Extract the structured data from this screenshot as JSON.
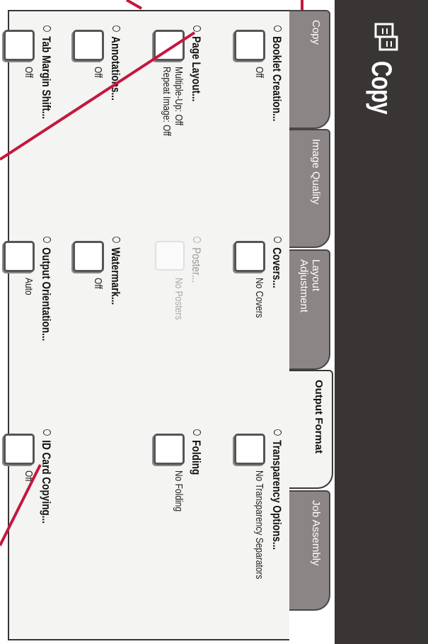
{
  "header": {
    "title": "Copy",
    "icon": "copier-icon"
  },
  "tabs": [
    {
      "label": "Copy",
      "active": false
    },
    {
      "label": "Image Quality",
      "active": false
    },
    {
      "label": "Layout\nAdjustment",
      "active": false
    },
    {
      "label": "Output Format",
      "active": true
    },
    {
      "label": "Job Assembly",
      "active": false
    }
  ],
  "features": {
    "booklet_creation": {
      "label": "Booklet Creation...",
      "value": "Off"
    },
    "covers": {
      "label": "Covers...",
      "value": "No Covers"
    },
    "transparency_options": {
      "label": "Transparency Options...",
      "value": "No Transparency Separators"
    },
    "page_layout": {
      "label": "Page Layout...",
      "value": "Multiple-Up: Off\nRepeat Image: Off"
    },
    "poster": {
      "label": "Poster...",
      "value": "No Posters",
      "enabled": false
    },
    "folding": {
      "label": "Folding",
      "value": "No Folding"
    },
    "annotations": {
      "label": "Annotations...",
      "value": "Off"
    },
    "watermark": {
      "label": "Watermark...",
      "value": "Off"
    },
    "tab_margin_shift": {
      "label": "Tab Margin Shift...",
      "value": "Off"
    },
    "output_orientation": {
      "label": "Output Orientation...",
      "value": "Auto"
    },
    "id_card_copying": {
      "label": "ID Card Copying...",
      "value": "Off"
    }
  },
  "colors": {
    "title_bar": "#3a3535",
    "panel": "#f4f4f2",
    "tab_inactive": "#8b8585",
    "callout_line": "#c4173f"
  }
}
